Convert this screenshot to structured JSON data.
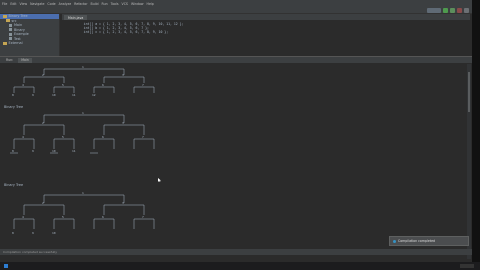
{
  "menu": [
    "File",
    "Edit",
    "View",
    "Navigate",
    "Code",
    "Analyze",
    "Refactor",
    "Build",
    "Run",
    "Tools",
    "VCS",
    "Window",
    "Help"
  ],
  "project": {
    "items": [
      "Binary Tree",
      "src",
      "Main",
      "Binary",
      "Example",
      "Test",
      "External"
    ]
  },
  "editor": {
    "tab": "Main.java",
    "code_lines": [
      "    int[] a = { 1, 2, 3, 4, 5, 6, 7, 8, 9, 10, 11, 12 };",
      "    int[] b = { 1, 2, 3, 4, 5, 6, 7 };",
      "    int[] c = { 1, 2, 3, 4, 5, 6, 7, 8, 9, 10 };"
    ]
  },
  "run": {
    "tabs": [
      "Run:",
      "Main"
    ],
    "section1": "Binary Tree",
    "section2": "Binary Tree",
    "section3": "Binary Tree"
  },
  "status": [
    "Compilation completed successfully"
  ],
  "notification": "Compilation completed"
}
